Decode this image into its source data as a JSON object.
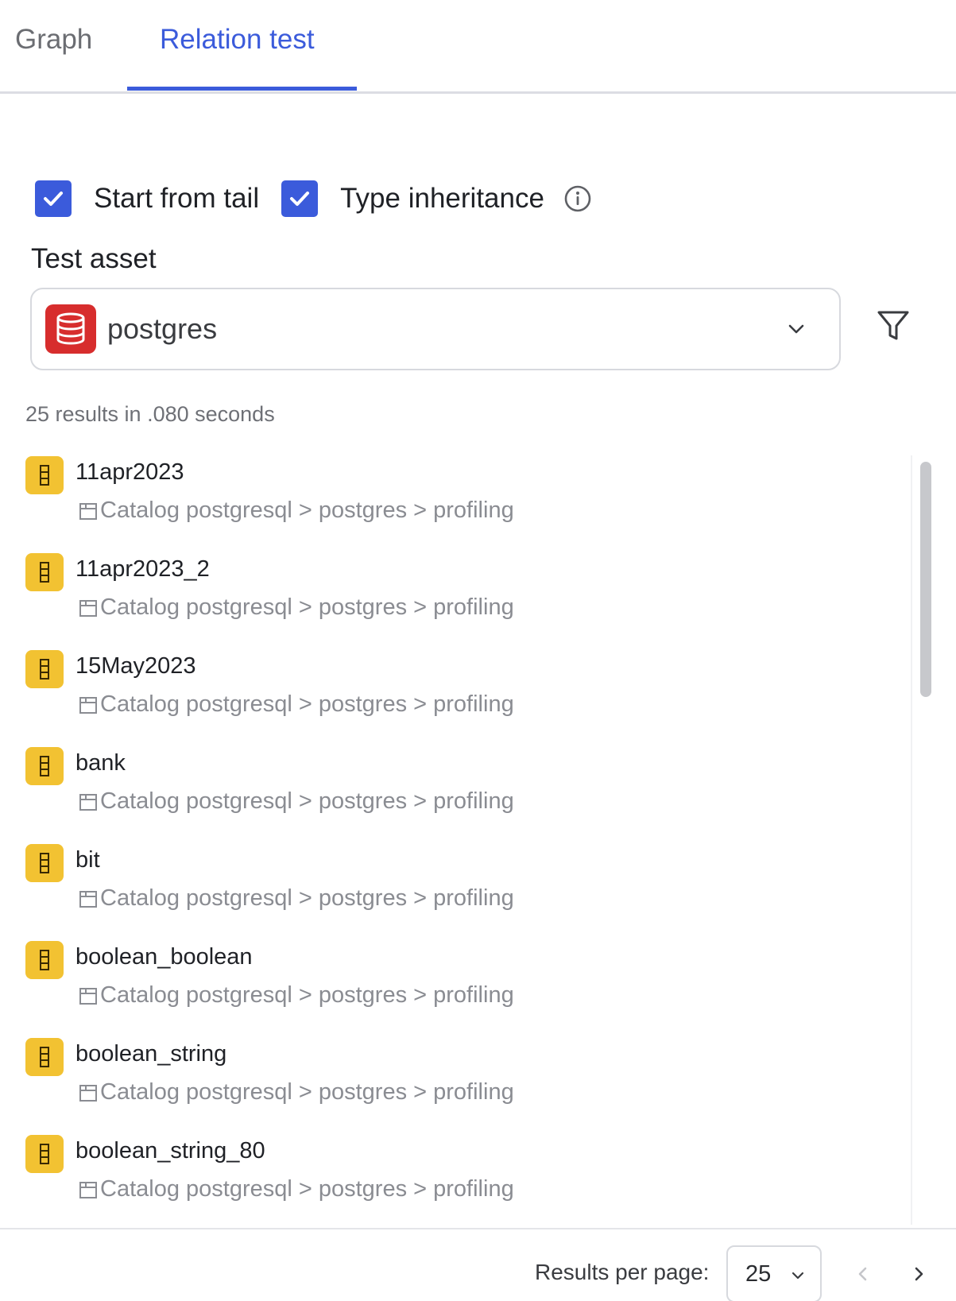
{
  "tabs": {
    "graph": "Graph",
    "relation_test": "Relation test"
  },
  "options": {
    "start_from_tail": "Start from tail",
    "type_inheritance": "Type inheritance"
  },
  "test_asset": {
    "label": "Test asset",
    "value": "postgres"
  },
  "results_summary": "25 results in .080 seconds",
  "results": [
    {
      "name": "11apr2023",
      "path": "Catalog postgresql > postgres > profiling"
    },
    {
      "name": "11apr2023_2",
      "path": "Catalog postgresql > postgres > profiling"
    },
    {
      "name": "15May2023",
      "path": "Catalog postgresql > postgres > profiling"
    },
    {
      "name": "bank",
      "path": "Catalog postgresql > postgres > profiling"
    },
    {
      "name": "bit",
      "path": "Catalog postgresql > postgres > profiling"
    },
    {
      "name": "boolean_boolean",
      "path": "Catalog postgresql > postgres > profiling"
    },
    {
      "name": "boolean_string",
      "path": "Catalog postgresql > postgres > profiling"
    },
    {
      "name": "boolean_string_80",
      "path": "Catalog postgresql > postgres > profiling"
    }
  ],
  "footer": {
    "results_per_page_label": "Results per page:",
    "results_per_page_value": "25"
  },
  "colors": {
    "accent": "#3b5bdb",
    "table_icon": "#f2c232",
    "database_icon": "#d72d2d"
  },
  "icons": {
    "database": "database-icon",
    "table": "table-icon",
    "schema": "schema-icon",
    "filter": "filter-icon",
    "info": "info-icon"
  }
}
